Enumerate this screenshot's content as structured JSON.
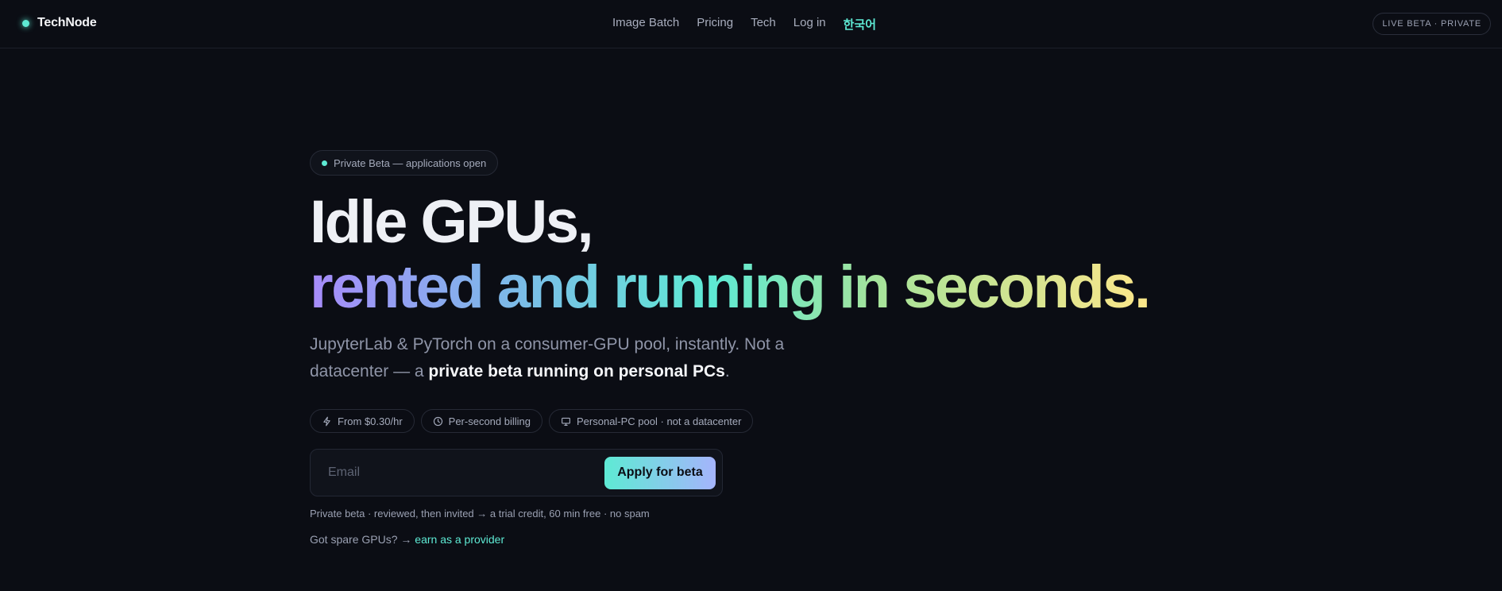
{
  "nav": {
    "logo_text": "TechNode",
    "links": [
      {
        "label": "Image Batch"
      },
      {
        "label": "Pricing"
      },
      {
        "label": "Tech"
      },
      {
        "label": "Log in"
      },
      {
        "label": "한국어"
      }
    ],
    "status_pill": "LIVE BETA · PRIVATE"
  },
  "hero": {
    "badge": "Private Beta — applications open",
    "headline_line1": "Idle GPUs,",
    "headline_line2": "rented and running in seconds.",
    "lead_plain": "JupyterLab & PyTorch on a consumer-GPU pool, instantly. Not a datacenter — a ",
    "lead_bold": "private beta running on personal PCs",
    "lead_end": ".",
    "chips": [
      {
        "icon": "bolt-icon",
        "label": "From $0.30/hr"
      },
      {
        "icon": "clock-icon",
        "label": "Per-second billing"
      },
      {
        "icon": "monitor-icon",
        "label": "Personal-PC pool · not a datacenter"
      }
    ],
    "email_placeholder": "Email",
    "email_value": "",
    "apply_label": "Apply for beta",
    "note": "Private beta · reviewed, then invited → a trial credit, 60 min free · no spam",
    "provider_prefix": "Got spare GPUs? → ",
    "provider_link": "earn as a provider"
  },
  "colors": {
    "background": "#0b0d14",
    "accent": "#5eead4",
    "gradient_start": "#a78bfa",
    "gradient_end": "#fde68a"
  }
}
